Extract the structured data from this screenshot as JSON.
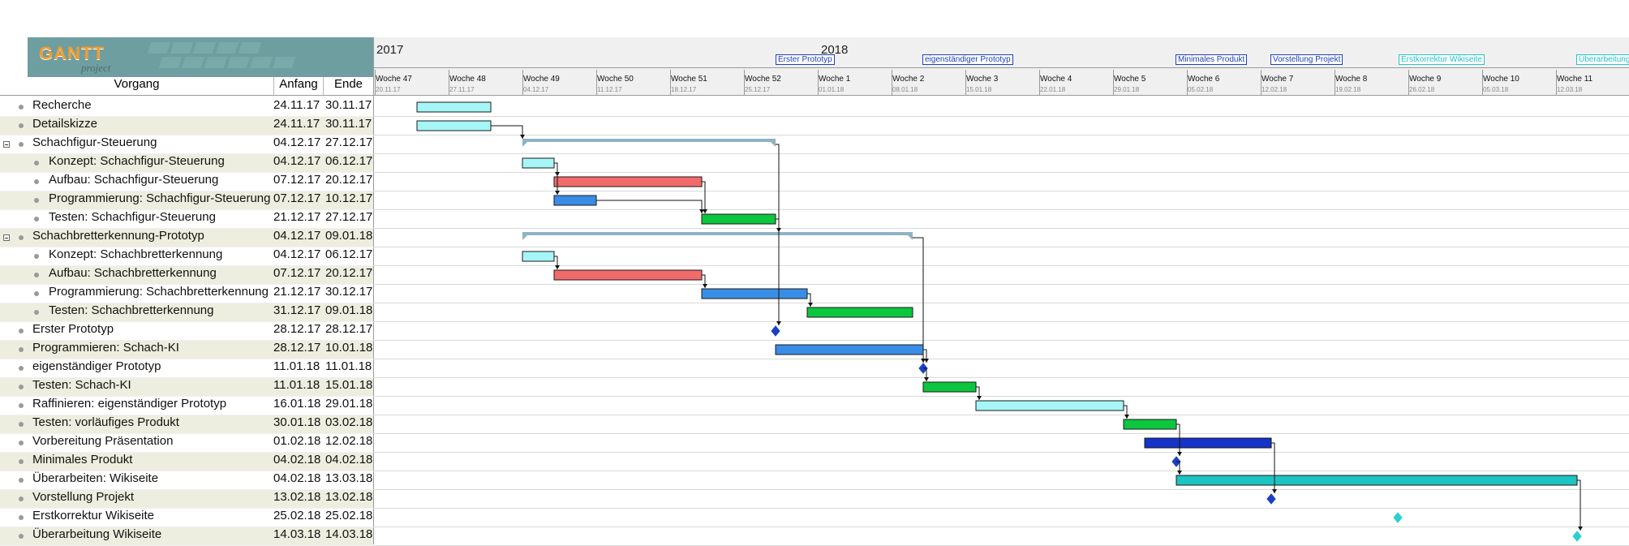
{
  "app": {
    "logo_text": "GANTT",
    "logo_sub": "project"
  },
  "table": {
    "columns": [
      "Vorgang",
      "Anfang",
      "Ende"
    ],
    "rows": [
      {
        "name": "Recherche",
        "start": "24.11.17",
        "end": "30.11.17",
        "level": 0,
        "collapsible": false
      },
      {
        "name": "Detailskizze",
        "start": "24.11.17",
        "end": "30.11.17",
        "level": 0,
        "collapsible": false
      },
      {
        "name": "Schachfigur-Steuerung",
        "start": "04.12.17",
        "end": "27.12.17",
        "level": 0,
        "collapsible": true
      },
      {
        "name": "Konzept: Schachfigur-Steuerung",
        "start": "04.12.17",
        "end": "06.12.17",
        "level": 1,
        "collapsible": false
      },
      {
        "name": "Aufbau: Schachfigur-Steuerung",
        "start": "07.12.17",
        "end": "20.12.17",
        "level": 1,
        "collapsible": false
      },
      {
        "name": "Programmierung: Schachfigur-Steuerung",
        "start": "07.12.17",
        "end": "10.12.17",
        "level": 1,
        "collapsible": false
      },
      {
        "name": "Testen: Schachfigur-Steuerung",
        "start": "21.12.17",
        "end": "27.12.17",
        "level": 1,
        "collapsible": false
      },
      {
        "name": "Schachbretterkennung-Prototyp",
        "start": "04.12.17",
        "end": "09.01.18",
        "level": 0,
        "collapsible": true
      },
      {
        "name": "Konzept: Schachbretterkennung",
        "start": "04.12.17",
        "end": "06.12.17",
        "level": 1,
        "collapsible": false
      },
      {
        "name": "Aufbau: Schachbretterkennung",
        "start": "07.12.17",
        "end": "20.12.17",
        "level": 1,
        "collapsible": false
      },
      {
        "name": "Programmierung: Schachbretterkennung",
        "start": "21.12.17",
        "end": "30.12.17",
        "level": 1,
        "collapsible": false
      },
      {
        "name": "Testen: Schachbretterkennung",
        "start": "31.12.17",
        "end": "09.01.18",
        "level": 1,
        "collapsible": false
      },
      {
        "name": "Erster Prototyp",
        "start": "28.12.17",
        "end": "28.12.17",
        "level": 0,
        "collapsible": false
      },
      {
        "name": "Programmieren: Schach-KI",
        "start": "28.12.17",
        "end": "10.01.18",
        "level": 0,
        "collapsible": false
      },
      {
        "name": "eigenständiger Prototyp",
        "start": "11.01.18",
        "end": "11.01.18",
        "level": 0,
        "collapsible": false
      },
      {
        "name": "Testen: Schach-KI",
        "start": "11.01.18",
        "end": "15.01.18",
        "level": 0,
        "collapsible": false
      },
      {
        "name": "Raffinieren: eigenständiger Prototyp",
        "start": "16.01.18",
        "end": "29.01.18",
        "level": 0,
        "collapsible": false
      },
      {
        "name": "Testen: vorläufiges Produkt",
        "start": "30.01.18",
        "end": "03.02.18",
        "level": 0,
        "collapsible": false
      },
      {
        "name": "Vorbereitung Präsentation",
        "start": "01.02.18",
        "end": "12.02.18",
        "level": 0,
        "collapsible": false
      },
      {
        "name": "Minimales Produkt",
        "start": "04.02.18",
        "end": "04.02.18",
        "level": 0,
        "collapsible": false
      },
      {
        "name": "Überarbeiten: Wikiseite",
        "start": "04.02.18",
        "end": "13.03.18",
        "level": 0,
        "collapsible": false
      },
      {
        "name": "Vorstellung Projekt",
        "start": "13.02.18",
        "end": "13.02.18",
        "level": 0,
        "collapsible": false
      },
      {
        "name": "Erstkorrektur Wikiseite",
        "start": "25.02.18",
        "end": "25.02.18",
        "level": 0,
        "collapsible": false
      },
      {
        "name": "Überarbeitung Wikiseite",
        "start": "14.03.18",
        "end": "14.03.18",
        "level": 0,
        "collapsible": false
      }
    ]
  },
  "timeline": {
    "years": [
      {
        "label": "2017"
      },
      {
        "label": "2018"
      }
    ],
    "weeks": [
      {
        "label": "Woche 47",
        "date": "20.11.17"
      },
      {
        "label": "Woche 48",
        "date": "27.11.17"
      },
      {
        "label": "Woche 49",
        "date": "04.12.17"
      },
      {
        "label": "Woche 50",
        "date": "11.12.17"
      },
      {
        "label": "Woche 51",
        "date": "18.12.17"
      },
      {
        "label": "Woche 52",
        "date": "25.12.17"
      },
      {
        "label": "Woche 1",
        "date": "01.01.18"
      },
      {
        "label": "Woche 2",
        "date": "08.01.18"
      },
      {
        "label": "Woche 3",
        "date": "15.01.18"
      },
      {
        "label": "Woche 4",
        "date": "22.01.18"
      },
      {
        "label": "Woche 5",
        "date": "29.01.18"
      },
      {
        "label": "Woche 6",
        "date": "05.02.18"
      },
      {
        "label": "Woche 7",
        "date": "12.02.18"
      },
      {
        "label": "Woche 8",
        "date": "19.02.18"
      },
      {
        "label": "Woche 9",
        "date": "26.02.18"
      },
      {
        "label": "Woche 10",
        "date": "05.03.18"
      },
      {
        "label": "Woche 11",
        "date": "12.03.18"
      }
    ],
    "milestone_labels": [
      {
        "label": "Erster Prototyp",
        "color": "blue"
      },
      {
        "label": "eigenständiger Prototyp",
        "color": "blue"
      },
      {
        "label": "Minimales Produkt",
        "color": "blue"
      },
      {
        "label": "Vorstellung Projekt",
        "color": "blue"
      },
      {
        "label": "Erstkorrektur Wikiseite",
        "color": "cyan"
      },
      {
        "label": "Überarbeitung Wikiseite",
        "color": "cyan"
      }
    ]
  },
  "colors": {
    "light_cyan": "#a6f5f7",
    "red": "#f26b6b",
    "blue": "#3a8de6",
    "green": "#0cc63f",
    "dark_blue": "#1533c8",
    "teal": "#1cc4c2",
    "summary": "#8fb2c4",
    "milestone_blue": "#1b3fc4",
    "milestone_cyan": "#2dcfd0"
  }
}
